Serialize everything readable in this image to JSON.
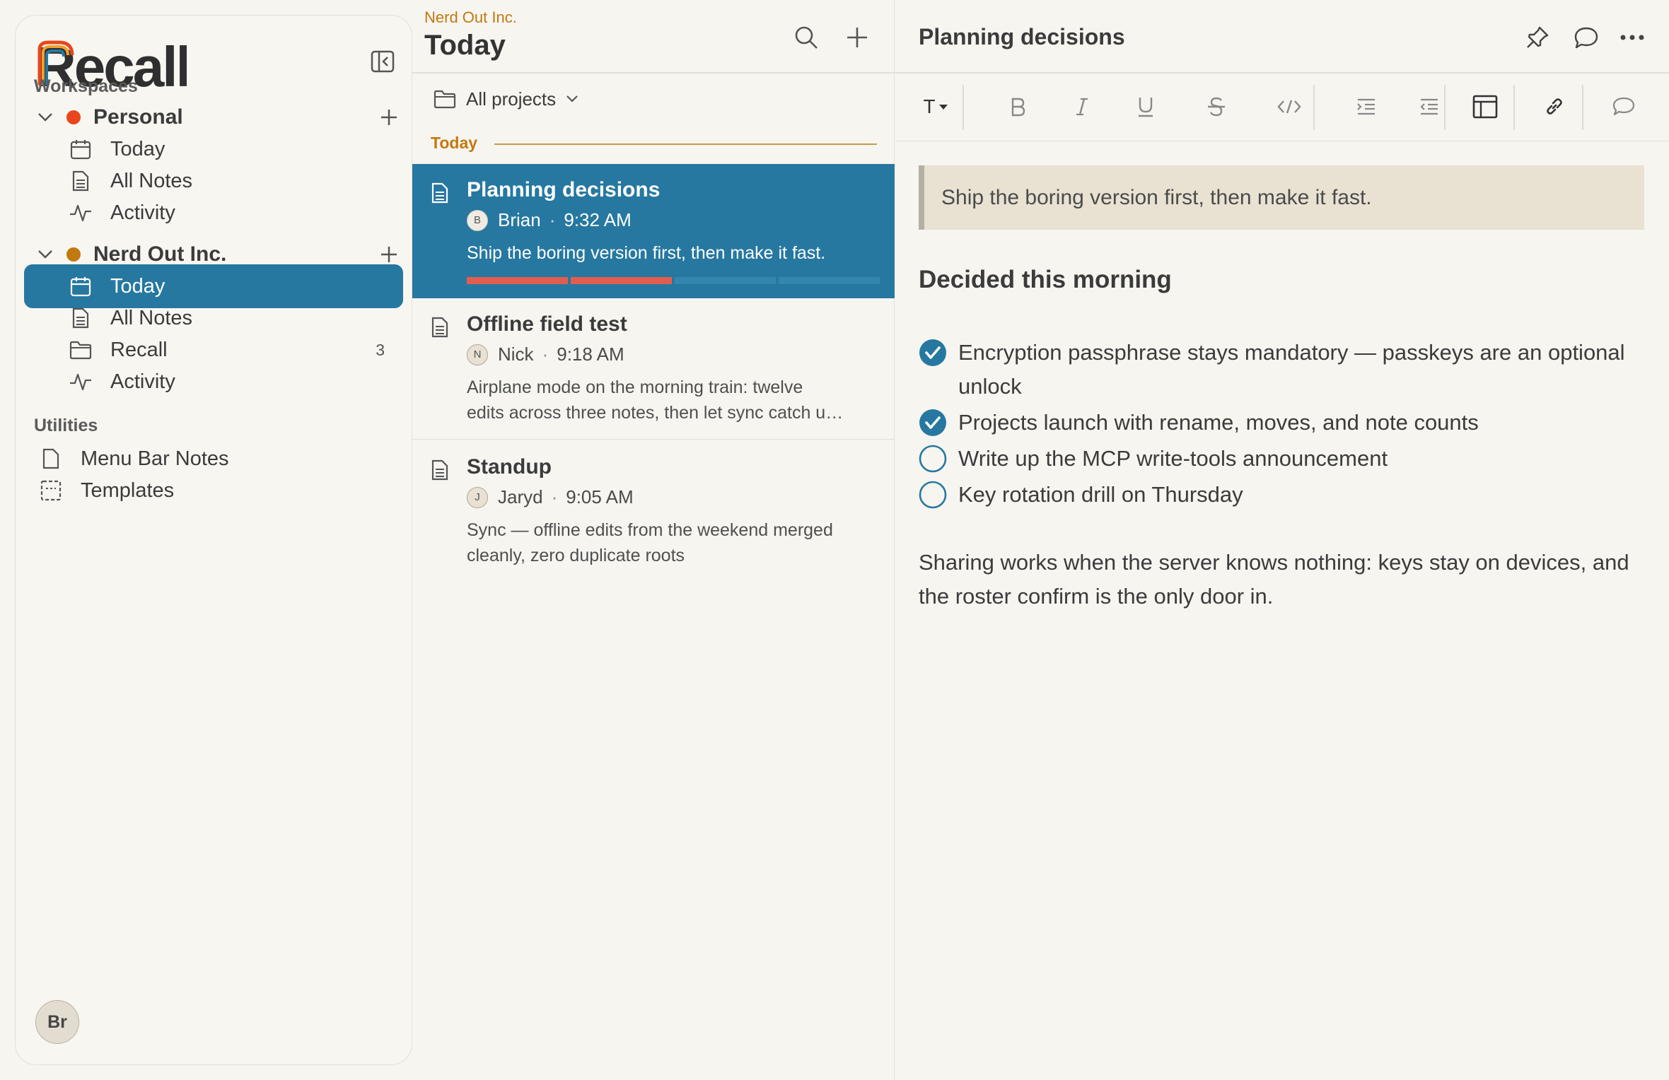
{
  "app": {
    "logo_text": "Recall"
  },
  "sidebar": {
    "workspaces_label": "Workspaces",
    "workspaces": [
      {
        "name": "Personal",
        "color": "#e8471d",
        "items": [
          {
            "label": "Today",
            "icon": "calendar-icon"
          },
          {
            "label": "All Notes",
            "icon": "document-icon"
          },
          {
            "label": "Activity",
            "icon": "activity-icon"
          }
        ]
      },
      {
        "name": "Nerd Out Inc.",
        "color": "#c2790f",
        "items": [
          {
            "label": "Today",
            "icon": "calendar-icon",
            "active": true
          },
          {
            "label": "All Notes",
            "icon": "document-icon"
          },
          {
            "label": "Recall",
            "icon": "folder-icon",
            "count": "3"
          },
          {
            "label": "Activity",
            "icon": "activity-icon"
          }
        ]
      }
    ],
    "utilities_label": "Utilities",
    "utilities": [
      {
        "label": "Menu Bar Notes",
        "icon": "note-page-icon"
      },
      {
        "label": "Templates",
        "icon": "template-icon"
      }
    ],
    "avatar_initials": "Br"
  },
  "list": {
    "breadcrumb": "Nerd Out Inc.",
    "title": "Today",
    "project_filter": "All projects",
    "date_heading": "Today",
    "notes": [
      {
        "title": "Planning decisions",
        "author_initial": "B",
        "author": "Brian",
        "time": "9:32 AM",
        "snippet": "Ship the boring version first, then make it fast.",
        "selected": true,
        "progress_color": "#e35d4f"
      },
      {
        "title": "Offline field test",
        "author_initial": "N",
        "author": "Nick",
        "time": "9:18 AM",
        "snippet_line1": "Airplane mode on the morning train: twelve",
        "snippet_line2": "edits across three notes, then let sync catch u…"
      },
      {
        "title": "Standup",
        "author_initial": "J",
        "author": "Jaryd",
        "time": "9:05 AM",
        "snippet_line1": "Sync — offline edits from the weekend merged",
        "snippet_line2": "cleanly, zero duplicate roots"
      }
    ],
    "separator": "·"
  },
  "editor": {
    "title": "Planning decisions",
    "toolbar": {
      "text_style": "T"
    },
    "quote": "Ship the boring version first, then make it fast.",
    "heading": "Decided this morning",
    "checklist": [
      {
        "text": "Encryption passphrase stays mandatory — passkeys are an optional unlock",
        "checked": true
      },
      {
        "text": "Projects launch with rename, moves, and note counts",
        "checked": true
      },
      {
        "text": "Write up the MCP write-tools announcement",
        "checked": false
      },
      {
        "text": "Key rotation drill on Thursday",
        "checked": false
      }
    ],
    "paragraph": "Sharing works when the server knows nothing: keys stay on devices, and the roster confirm is the only door in.",
    "check_color": "#2678a0"
  }
}
